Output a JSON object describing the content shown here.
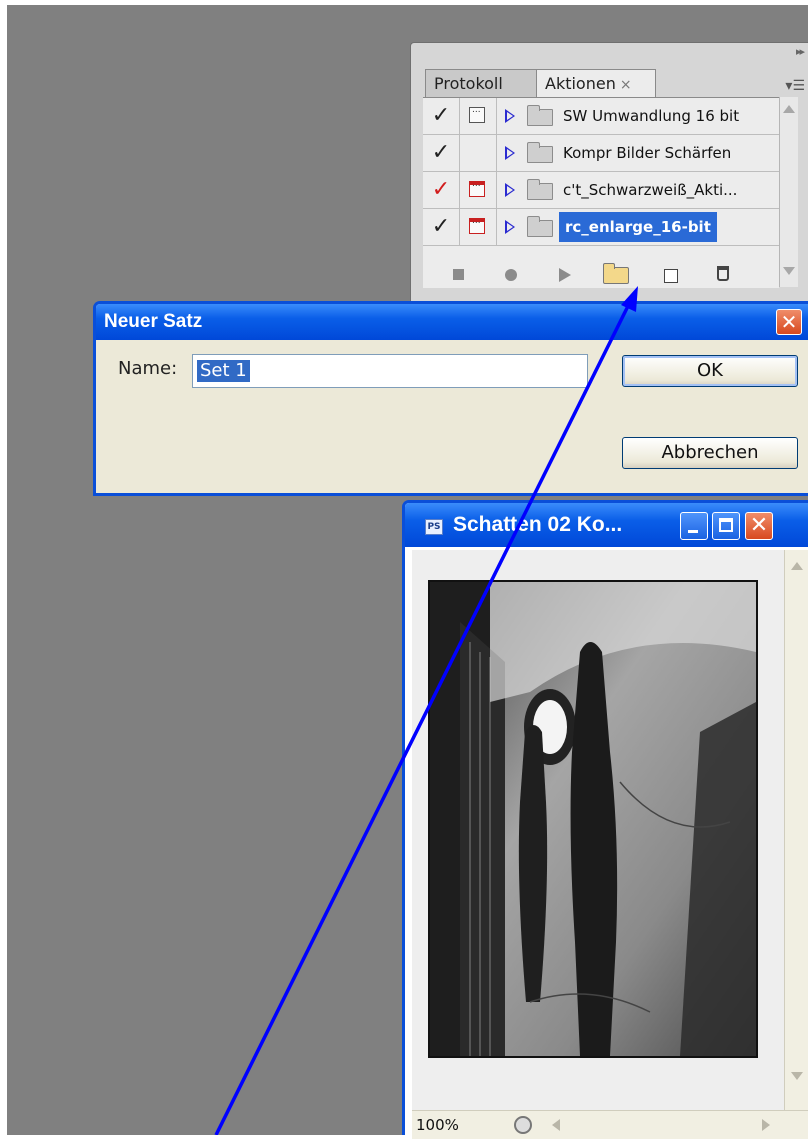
{
  "actions_panel": {
    "tabs": [
      {
        "label": "Protokoll"
      },
      {
        "label": "Aktionen",
        "close": "×"
      }
    ],
    "menu_icon": "panel-menu-icon",
    "collapse_icon": "double-chevron-icon",
    "rows": [
      {
        "label": "SW Umwandlung 16 bit",
        "check_color": "black",
        "dialog_toggle": true,
        "dialog_color": "black"
      },
      {
        "label": "Kompr Bilder Schärfen",
        "check_color": "black",
        "dialog_toggle": false,
        "dialog_color": "none"
      },
      {
        "label": "c't_Schwarzweiß_Akti...",
        "check_color": "#d11c1c",
        "dialog_toggle": true,
        "dialog_color": "#c82020"
      },
      {
        "label": "rc_enlarge_16-bit",
        "check_color": "black",
        "dialog_toggle": true,
        "dialog_color": "#c82020",
        "selected": true
      }
    ],
    "check_glyph": "✓",
    "toolbar_icons": [
      "stop-icon",
      "record-icon",
      "play-icon",
      "new-set-icon",
      "new-action-icon",
      "trash-icon"
    ]
  },
  "dialog": {
    "title": "Neuer Satz",
    "close_glyph": "✕",
    "name_label": "Name:",
    "name_value": "Set 1",
    "ok_label": "OK",
    "cancel_label": "Abbrechen"
  },
  "document": {
    "app_icon": "PS",
    "title": "Schatten 02 Ko...",
    "zoom": "100%",
    "close_glyph": "✕"
  },
  "colors": {
    "workspace": "#808080",
    "xp_titlebar": "#0a5ee8",
    "selection": "#2a6ad6",
    "annotation_arrow": "#0000ff"
  }
}
